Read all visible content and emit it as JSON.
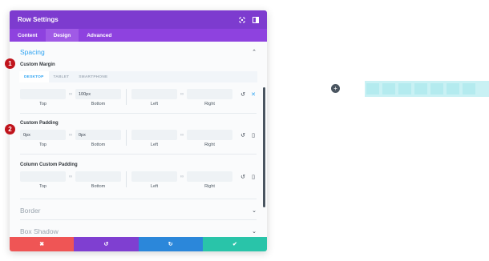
{
  "modal": {
    "title": "Row Settings",
    "tabs": [
      {
        "label": "Content"
      },
      {
        "label": "Design"
      },
      {
        "label": "Advanced"
      }
    ]
  },
  "spacing": {
    "title": "Spacing",
    "custom_margin": {
      "label": "Custom Margin",
      "device_tabs": [
        "DESKTOP",
        "TABLET",
        "SMARTPHONE"
      ],
      "active_device": "DESKTOP",
      "fields": {
        "top": {
          "value": "",
          "label": "Top"
        },
        "bottom": {
          "value": "100px",
          "label": "Bottom"
        },
        "left": {
          "value": "",
          "label": "Left"
        },
        "right": {
          "value": "",
          "label": "Right"
        }
      }
    },
    "custom_padding": {
      "label": "Custom Padding",
      "fields": {
        "top": {
          "value": "0px",
          "label": "Top"
        },
        "bottom": {
          "value": "0px",
          "label": "Bottom"
        },
        "left": {
          "value": "",
          "label": "Left"
        },
        "right": {
          "value": "",
          "label": "Right"
        }
      }
    },
    "column_padding": {
      "label": "Column Custom Padding",
      "fields": {
        "top": {
          "value": "",
          "label": "Top"
        },
        "bottom": {
          "value": "",
          "label": "Bottom"
        },
        "left": {
          "value": "",
          "label": "Left"
        },
        "right": {
          "value": "",
          "label": "Right"
        }
      }
    }
  },
  "sections": {
    "border": "Border",
    "box_shadow": "Box Shadow"
  },
  "badges": {
    "one": "1",
    "two": "2"
  },
  "colors": {
    "header": "#7d3bcf",
    "tabs": "#8e42df",
    "accent": "#2ea3f2",
    "cancel": "#ef5555",
    "undo": "#7f3fd1",
    "redo": "#2b87da",
    "save": "#29c4a9",
    "badge": "#c0141c"
  },
  "icons": [
    "expand-icon",
    "sidebar-toggle-icon",
    "chevron-up-icon",
    "chevron-down-icon",
    "link-icon",
    "reset-icon",
    "close-icon",
    "phone-icon",
    "undo-icon",
    "redo-icon",
    "check-icon",
    "plus-icon"
  ]
}
